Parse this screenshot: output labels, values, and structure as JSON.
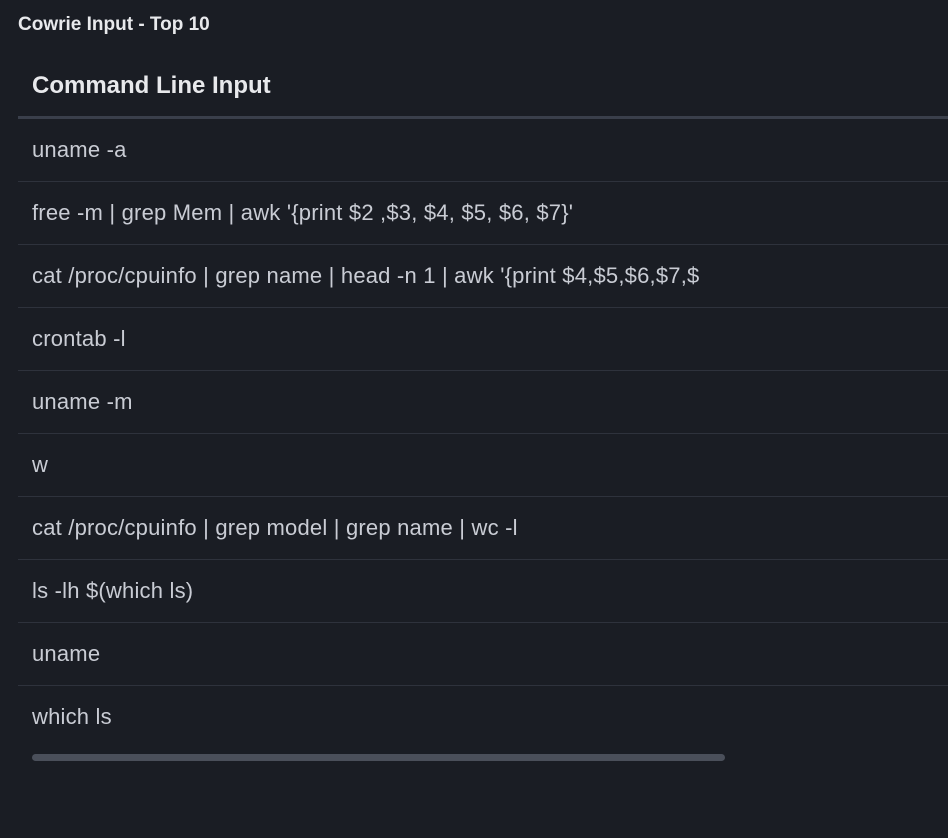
{
  "panel": {
    "title": "Cowrie Input - Top 10"
  },
  "table": {
    "header": "Command Line Input",
    "rows": [
      "uname -a",
      "free -m | grep Mem | awk '{print $2 ,$3, $4, $5, $6, $7}'",
      "cat /proc/cpuinfo | grep name | head -n 1 | awk '{print $4,$5,$6,$7,$",
      "crontab -l",
      "uname -m",
      "w",
      "cat /proc/cpuinfo | grep model | grep name | wc -l",
      "ls -lh $(which ls)",
      "uname",
      "which ls"
    ]
  }
}
